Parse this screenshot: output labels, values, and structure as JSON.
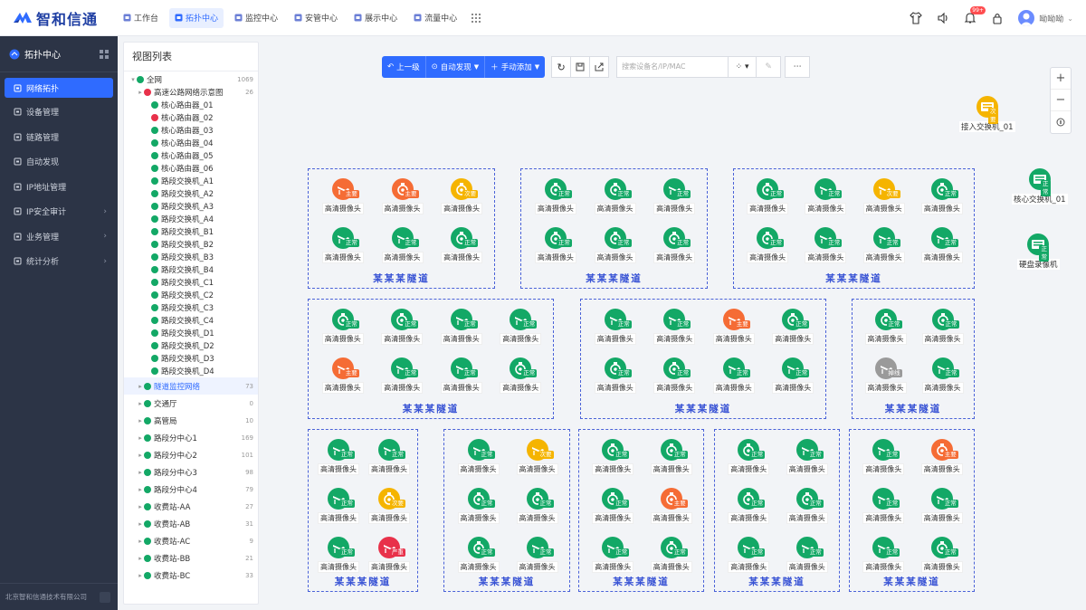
{
  "app": {
    "brand": "智和信通",
    "colors": {
      "primary": "#2f6bff",
      "normal": "#13a866",
      "major": "#f56c35",
      "minor": "#f5b400",
      "critical": "#e8314a",
      "offline": "#9a9a9a"
    }
  },
  "topnav": [
    {
      "label": "工作台",
      "icon": "home-icon"
    },
    {
      "label": "拓扑中心",
      "icon": "topology-icon",
      "active": true
    },
    {
      "label": "监控中心",
      "icon": "monitor-icon"
    },
    {
      "label": "安管中心",
      "icon": "shield-icon"
    },
    {
      "label": "展示中心",
      "icon": "display-icon"
    },
    {
      "label": "流量中心",
      "icon": "flow-icon"
    }
  ],
  "topright": {
    "notification_count": "99+",
    "username": "呦呦呦"
  },
  "sidebar": {
    "title": "拓扑中心",
    "items": [
      {
        "label": "网络拓扑",
        "icon": "network-icon",
        "active": true
      },
      {
        "label": "设备管理",
        "icon": "device-icon"
      },
      {
        "label": "链路管理",
        "icon": "link-icon"
      },
      {
        "label": "自动发现",
        "icon": "discover-icon"
      },
      {
        "label": "IP地址管理",
        "icon": "ip-icon"
      },
      {
        "label": "IP安全审计",
        "icon": "audit-icon",
        "has_children": true
      },
      {
        "label": "业务管理",
        "icon": "business-icon",
        "has_children": true
      },
      {
        "label": "统计分析",
        "icon": "stats-icon",
        "has_children": true
      }
    ],
    "footer": "北京智和信通技术有限公司"
  },
  "tree": {
    "title": "视图列表",
    "nodes": [
      {
        "label": "全网",
        "count": "1069",
        "level": 0,
        "color": "#13a866",
        "arrow": "▾"
      },
      {
        "label": "高速公路网络示意图",
        "count": "26",
        "level": 1,
        "color": "#e8314a",
        "arrow": "▸"
      },
      {
        "label": "核心路由器_01",
        "level": 2,
        "color": "#13a866"
      },
      {
        "label": "核心路由器_02",
        "level": 2,
        "color": "#e8314a"
      },
      {
        "label": "核心路由器_03",
        "level": 2,
        "color": "#13a866"
      },
      {
        "label": "核心路由器_04",
        "level": 2,
        "color": "#13a866"
      },
      {
        "label": "核心路由器_05",
        "level": 2,
        "color": "#13a866"
      },
      {
        "label": "核心路由器_06",
        "level": 2,
        "color": "#13a866"
      },
      {
        "label": "路段交换机_A1",
        "level": 2,
        "color": "#13a866"
      },
      {
        "label": "路段交换机_A2",
        "level": 2,
        "color": "#13a866"
      },
      {
        "label": "路段交换机_A3",
        "level": 2,
        "color": "#13a866"
      },
      {
        "label": "路段交换机_A4",
        "level": 2,
        "color": "#13a866"
      },
      {
        "label": "路段交换机_B1",
        "level": 2,
        "color": "#13a866"
      },
      {
        "label": "路段交换机_B2",
        "level": 2,
        "color": "#13a866"
      },
      {
        "label": "路段交换机_B3",
        "level": 2,
        "color": "#13a866"
      },
      {
        "label": "路段交换机_B4",
        "level": 2,
        "color": "#13a866"
      },
      {
        "label": "路段交换机_C1",
        "level": 2,
        "color": "#13a866"
      },
      {
        "label": "路段交换机_C2",
        "level": 2,
        "color": "#13a866"
      },
      {
        "label": "路段交换机_C3",
        "level": 2,
        "color": "#13a866"
      },
      {
        "label": "路段交换机_C4",
        "level": 2,
        "color": "#13a866"
      },
      {
        "label": "路段交换机_D1",
        "level": 2,
        "color": "#13a866"
      },
      {
        "label": "路段交换机_D2",
        "level": 2,
        "color": "#13a866"
      },
      {
        "label": "路段交换机_D3",
        "level": 2,
        "color": "#13a866"
      },
      {
        "label": "路段交换机_D4",
        "level": 2,
        "color": "#13a866"
      },
      {
        "label": "隧道监控网络",
        "count": "73",
        "level": 1,
        "color": "#13a866",
        "arrow": "▸",
        "selected": true
      },
      {
        "label": "交通厅",
        "count": "0",
        "level": 1,
        "color": "#13a866",
        "arrow": "▸"
      },
      {
        "label": "高管局",
        "count": "10",
        "level": 1,
        "color": "#13a866",
        "arrow": "▸"
      },
      {
        "label": "路段分中心1",
        "count": "169",
        "level": 1,
        "color": "#13a866",
        "arrow": "▸"
      },
      {
        "label": "路段分中心2",
        "count": "101",
        "level": 1,
        "color": "#13a866",
        "arrow": "▸"
      },
      {
        "label": "路段分中心3",
        "count": "98",
        "level": 1,
        "color": "#13a866",
        "arrow": "▸"
      },
      {
        "label": "路段分中心4",
        "count": "79",
        "level": 1,
        "color": "#13a866",
        "arrow": "▸"
      },
      {
        "label": "收费站-AA",
        "count": "27",
        "level": 1,
        "color": "#13a866",
        "arrow": "▸"
      },
      {
        "label": "收费站-AB",
        "count": "31",
        "level": 1,
        "color": "#13a866",
        "arrow": "▸"
      },
      {
        "label": "收费站-AC",
        "count": "9",
        "level": 1,
        "color": "#13a866",
        "arrow": "▸"
      },
      {
        "label": "收费站-BB",
        "count": "21",
        "level": 1,
        "color": "#13a866",
        "arrow": "▸"
      },
      {
        "label": "收费站-BC",
        "count": "33",
        "level": 1,
        "color": "#13a866",
        "arrow": "▸"
      }
    ]
  },
  "toolbar": {
    "up_label": "上一级",
    "auto_label": "自动发现",
    "add_label": "手动添加",
    "search_placeholder": "搜索设备名/IP/MAC"
  },
  "side_devices": [
    {
      "label": "接入交换机_01",
      "status": "次要"
    },
    {
      "label": "核心交换机_01",
      "status": "正常"
    },
    {
      "label": "硬盘录像机",
      "status": "正常"
    }
  ],
  "groups": [
    {
      "title": "某某某隧道",
      "devices": [
        [
          "主要",
          "cam"
        ],
        [
          "主要",
          "dome"
        ],
        [
          "次要",
          "dome"
        ],
        [
          "正常",
          "cam"
        ],
        [
          "正常",
          "cam"
        ],
        [
          "正常",
          "dome"
        ]
      ]
    },
    {
      "title": "某某某隧道",
      "devices": [
        [
          "正常",
          "dome"
        ],
        [
          "正常",
          "dome"
        ],
        [
          "正常",
          "cam"
        ],
        [
          "正常",
          "dome"
        ],
        [
          "正常",
          "dome"
        ],
        [
          "正常",
          "dome"
        ]
      ]
    },
    {
      "title": "某某某隧道",
      "devices": [
        [
          "正常",
          "dome"
        ],
        [
          "正常",
          "cam"
        ],
        [
          "次要",
          "cam"
        ],
        [
          "正常",
          "dome"
        ],
        [
          "正常",
          "dome"
        ],
        [
          "正常",
          "cam"
        ],
        [
          "正常",
          "cam"
        ],
        [
          "正常",
          "cam"
        ]
      ]
    },
    {
      "title": "某某某隧道",
      "devices": [
        [
          "正常",
          "dome"
        ],
        [
          "正常",
          "dome"
        ],
        [
          "正常",
          "cam"
        ],
        [
          "正常",
          "cam"
        ],
        [
          "主要",
          "cam"
        ],
        [
          "正常",
          "cam"
        ],
        [
          "正常",
          "cam"
        ],
        [
          "正常",
          "dome"
        ]
      ]
    },
    {
      "title": "某某某隧道",
      "devices": [
        [
          "正常",
          "cam"
        ],
        [
          "正常",
          "cam"
        ],
        [
          "主要",
          "cam"
        ],
        [
          "正常",
          "dome"
        ],
        [
          "正常",
          "dome"
        ],
        [
          "正常",
          "dome"
        ],
        [
          "正常",
          "cam"
        ],
        [
          "正常",
          "cam"
        ]
      ]
    },
    {
      "title": "某某某隧道",
      "devices": [
        [
          "正常",
          "dome"
        ],
        [
          "正常",
          "dome"
        ],
        [
          "掉线",
          "cam"
        ],
        [
          "正常",
          "cam"
        ]
      ]
    },
    {
      "title": "某某某隧道",
      "devices": [
        [
          "正常",
          "cam"
        ],
        [
          "正常",
          "cam"
        ],
        [
          "正常",
          "cam"
        ],
        [
          "次要",
          "dome"
        ],
        [
          "正常",
          "cam"
        ],
        [
          "严重",
          "cam"
        ]
      ]
    },
    {
      "title": "某某某隧道",
      "devices": [
        [
          "正常",
          "cam"
        ],
        [
          "次要",
          "cam"
        ],
        [
          "正常",
          "dome"
        ],
        [
          "正常",
          "dome"
        ],
        [
          "正常",
          "dome"
        ],
        [
          "正常",
          "cam"
        ]
      ]
    },
    {
      "title": "某某某隧道",
      "devices": [
        [
          "正常",
          "dome"
        ],
        [
          "正常",
          "dome"
        ],
        [
          "正常",
          "dome"
        ],
        [
          "主要",
          "dome"
        ],
        [
          "正常",
          "cam"
        ],
        [
          "正常",
          "dome"
        ]
      ]
    },
    {
      "title": "某某某隧道",
      "devices": [
        [
          "正常",
          "dome"
        ],
        [
          "正常",
          "cam"
        ],
        [
          "正常",
          "dome"
        ],
        [
          "正常",
          "dome"
        ],
        [
          "正常",
          "cam"
        ],
        [
          "正常",
          "cam"
        ]
      ]
    },
    {
      "title": "某某某隧道",
      "devices": [
        [
          "正常",
          "cam"
        ],
        [
          "主要",
          "dome"
        ],
        [
          "正常",
          "cam"
        ],
        [
          "正常",
          "cam"
        ],
        [
          "正常",
          "cam"
        ],
        [
          "正常",
          "dome"
        ]
      ]
    }
  ],
  "device_label": "高清摄像头"
}
